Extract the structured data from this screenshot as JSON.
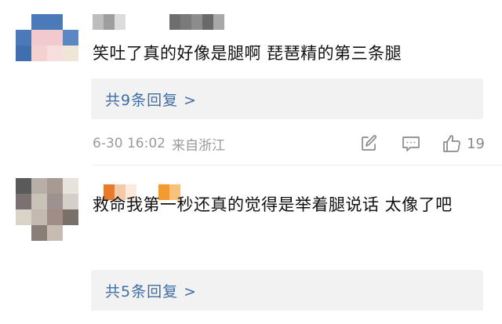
{
  "comments": [
    {
      "avatar_pixels": [
        "#ffffff",
        "#4a7ab8",
        "#4a7ab8",
        "#ffffff",
        "#4a7ab8",
        "#f2c9cc",
        "#f2c9cc",
        "#5b87c2",
        "#3f6fae",
        "#f5d0d0",
        "#f7dede",
        "#efe6d8",
        "#ffffff",
        "#ffffff",
        "#ffffff",
        "#ffffff"
      ],
      "name_blocks": [
        "#bdbdbd",
        "#9e9e9e",
        "#dcdcdc",
        "#ffffff",
        "#ffffff",
        "#ffffff",
        "#ffffff",
        "#6e6e6e",
        "#7a7a7a",
        "#8c8c8c",
        "#6a6a6a",
        "#a8a8a8"
      ],
      "text": "笑吐了真的好像是腿啊 琵琶精的第三条腿",
      "reply_link": "共9条回复 >",
      "date": "6-30 16:02",
      "source": "来自浙江",
      "likes": "19"
    },
    {
      "avatar_pixels": [
        "#5a5a5a",
        "#b8b0a8",
        "#a89a92",
        "#e6e2dc",
        "#7a7270",
        "#c8c2b8",
        "#9e9290",
        "#d4d0c8",
        "#d8d4c8",
        "#c2bab0",
        "#a08e86",
        "#7a706a",
        "#ffffff",
        "#8a7e78",
        "#c6bcb2",
        "#ffffff"
      ],
      "name_blocks": [
        "#ffffff",
        "#e87a2c",
        "#f3c9a8",
        "#fbe9dc",
        "#ffffff",
        "#ffffff",
        "#f59a30",
        "#f9c27a"
      ],
      "text": "救命我第一秒还真的觉得是举着腿说话  太像了吧",
      "reply_link": "共5条回复 >"
    }
  ],
  "icons": {
    "share": "share-icon",
    "comment": "comment-icon",
    "like": "thumbs-up-icon"
  },
  "colors": {
    "link": "#3e6da6",
    "meta": "#9a9a9a",
    "reply_bg": "#f2f2f2"
  }
}
